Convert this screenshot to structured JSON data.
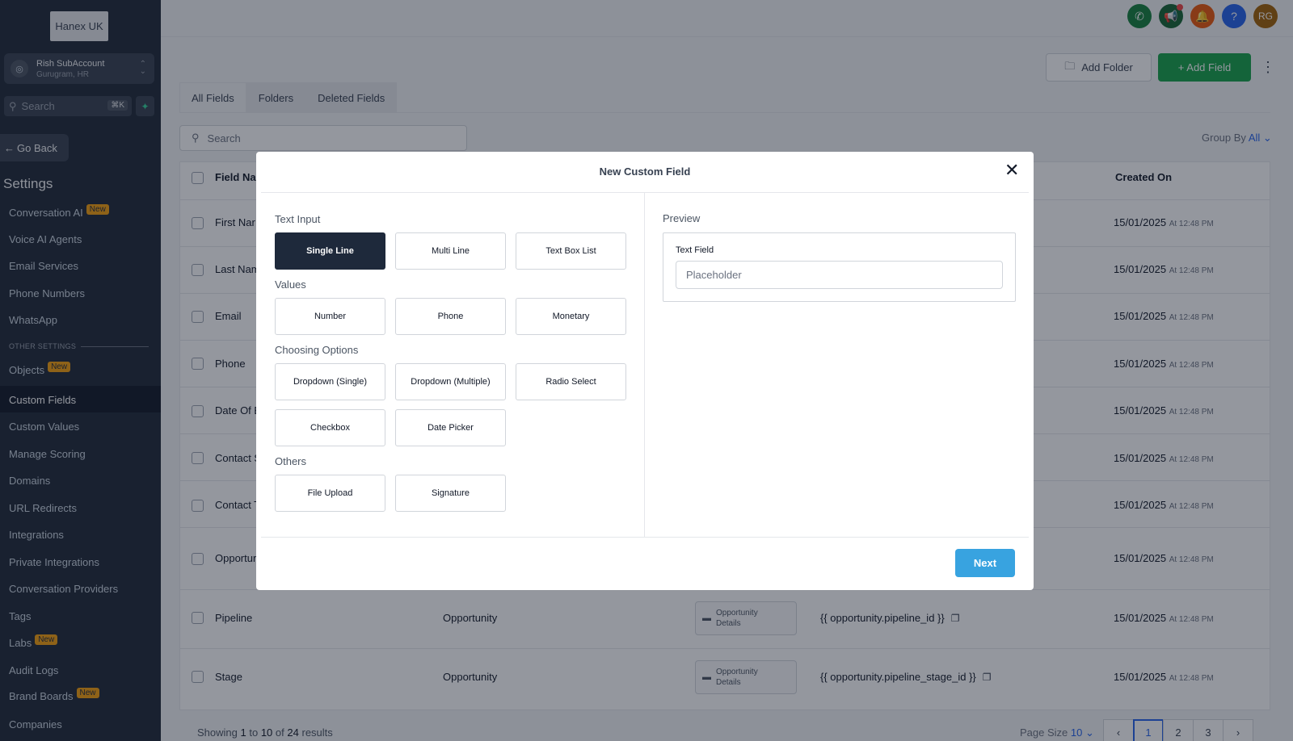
{
  "sidebar": {
    "logo": "Hanex UK",
    "account": {
      "name": "Rish SubAccount",
      "location": "Gurugram, HR"
    },
    "search": {
      "placeholder": "Search",
      "shortcut": "⌘K"
    },
    "go_back": "Go Back",
    "title": "Settings",
    "badge_new": "New",
    "other_settings": "OTHER SETTINGS",
    "items": [
      {
        "label": "Conversation AI",
        "badge": true
      },
      {
        "label": "Voice AI Agents",
        "badge": false
      },
      {
        "label": "Email Services",
        "badge": false
      },
      {
        "label": "Phone Numbers",
        "badge": false
      },
      {
        "label": "WhatsApp",
        "badge": false
      }
    ],
    "other_items": [
      {
        "label": "Objects",
        "badge": true
      },
      {
        "label": "Custom Fields",
        "badge": false,
        "active": true
      },
      {
        "label": "Custom Values",
        "badge": false
      },
      {
        "label": "Manage Scoring",
        "badge": false
      },
      {
        "label": "Domains",
        "badge": false
      },
      {
        "label": "URL Redirects",
        "badge": false
      },
      {
        "label": "Integrations",
        "badge": false
      },
      {
        "label": "Private Integrations",
        "badge": false
      },
      {
        "label": "Conversation Providers",
        "badge": false
      },
      {
        "label": "Tags",
        "badge": false
      },
      {
        "label": "Labs",
        "badge": true
      },
      {
        "label": "Audit Logs",
        "badge": false
      },
      {
        "label": "Brand Boards",
        "badge": true
      },
      {
        "label": "Companies",
        "badge": false
      }
    ]
  },
  "topbar": {
    "avatar_initials": "RG",
    "help": "?",
    "icons": [
      "phone-icon",
      "megaphone-icon",
      "bell-icon",
      "help-icon"
    ],
    "colors": {
      "phone": "#15803d",
      "megaphone": "#166534",
      "bell": "#ea580c",
      "help": "#2563eb",
      "avatar": "#a16207"
    }
  },
  "toolbar": {
    "add_folder": "Add Folder",
    "add_field": "+ Add Field"
  },
  "tabs": [
    "All Fields",
    "Folders",
    "Deleted Fields"
  ],
  "main_search": {
    "placeholder": "Search"
  },
  "group_by": {
    "label": "Group By",
    "value": "All"
  },
  "table": {
    "headers": {
      "field_name": "Field Na",
      "created_on": "Created On"
    },
    "rows": [
      {
        "name": "First Nar",
        "created": "15/01/2025",
        "time": "At 12:48 PM"
      },
      {
        "name": "Last Nam",
        "created": "15/01/2025",
        "time": "At 12:48 PM"
      },
      {
        "name": "Email",
        "created": "15/01/2025",
        "time": "At 12:48 PM"
      },
      {
        "name": "Phone",
        "created": "15/01/2025",
        "time": "At 12:48 PM"
      },
      {
        "name": "Date Of E",
        "created": "15/01/2025",
        "time": "At 12:48 PM"
      },
      {
        "name": "Contact S",
        "created": "15/01/2025",
        "time": "At 12:48 PM"
      },
      {
        "name": "Contact T",
        "created": "15/01/2025",
        "time": "At 12:48 PM"
      },
      {
        "name": "Opportur",
        "created": "15/01/2025",
        "time": "At 12:48 PM"
      },
      {
        "name": "Pipeline",
        "object": "Opportunity",
        "folder": "Opportunity Details",
        "key": "{{ opportunity.pipeline_id }}",
        "created": "15/01/2025",
        "time": "At 12:48 PM"
      },
      {
        "name": "Stage",
        "object": "Opportunity",
        "folder": "Opportunity Details",
        "key": "{{ opportunity.pipeline_stage_id }}",
        "created": "15/01/2025",
        "time": "At 12:48 PM"
      }
    ]
  },
  "footer": {
    "showing": "Showing",
    "from": "1",
    "to_word": "to",
    "to": "10",
    "of_word": "of",
    "total": "24",
    "results": "results",
    "page_size_label": "Page Size",
    "page_size": "10",
    "pages": [
      "1",
      "2",
      "3"
    ],
    "prev": "‹",
    "next": "›"
  },
  "modal": {
    "title": "New Custom Field",
    "sections": {
      "text_input": "Text Input",
      "values": "Values",
      "choosing": "Choosing Options",
      "others": "Others"
    },
    "options": {
      "single_line": "Single Line",
      "multi_line": "Multi Line",
      "text_box_list": "Text Box List",
      "number": "Number",
      "phone": "Phone",
      "monetary": "Monetary",
      "dropdown_single": "Dropdown (Single)",
      "dropdown_multiple": "Dropdown (Multiple)",
      "radio_select": "Radio Select",
      "checkbox": "Checkbox",
      "date_picker": "Date Picker",
      "file_upload": "File Upload",
      "signature": "Signature"
    },
    "selected": "Single Line",
    "preview": {
      "label": "Preview",
      "field_label": "Text Field",
      "placeholder": "Placeholder"
    },
    "next": "Next"
  }
}
